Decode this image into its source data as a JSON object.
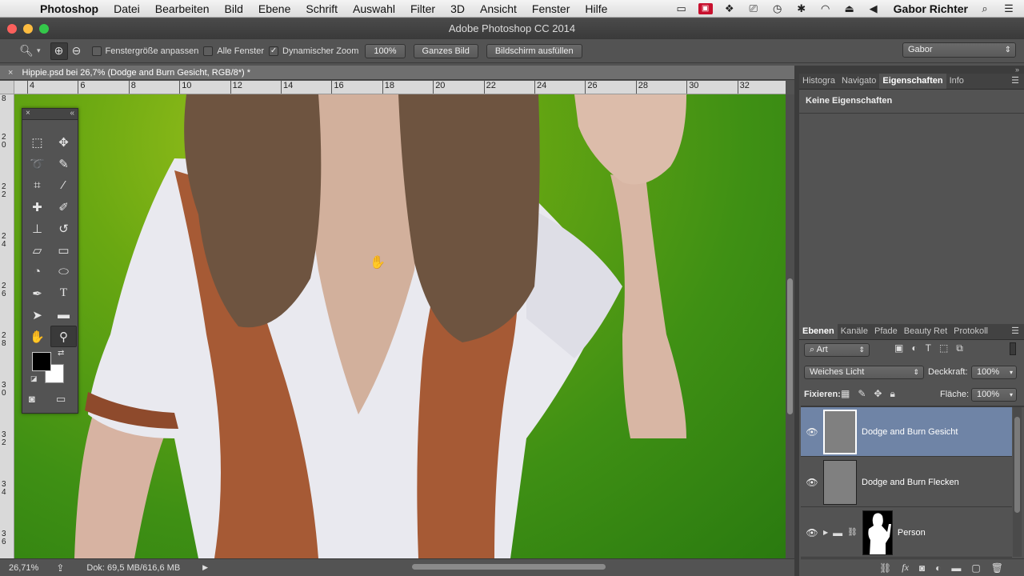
{
  "menubar": {
    "app": "Photoshop",
    "items": [
      "Datei",
      "Bearbeiten",
      "Bild",
      "Ebene",
      "Schrift",
      "Auswahl",
      "Filter",
      "3D",
      "Ansicht",
      "Fenster",
      "Hilfe"
    ],
    "user": "Gabor Richter"
  },
  "window": {
    "title": "Adobe Photoshop CC 2014"
  },
  "options": {
    "fit_window": "Fenstergröße anpassen",
    "all_windows": "Alle Fenster",
    "dynamic_zoom": "Dynamischer Zoom",
    "zoom_value": "100%",
    "full_image": "Ganzes Bild",
    "fill_screen": "Bildschirm ausfüllen",
    "workspace": "Gabor"
  },
  "document": {
    "tab_title": "Hippie.psd bei 26,7% (Dodge and Burn Gesicht, RGB/8*) *",
    "ruler_h": [
      "4",
      "6",
      "8",
      "10",
      "12",
      "14",
      "16",
      "18",
      "20",
      "22",
      "24",
      "26",
      "28",
      "30",
      "32"
    ],
    "ruler_v": [
      "8",
      "20",
      "22",
      "24",
      "26",
      "28",
      "30",
      "32",
      "34",
      "36"
    ]
  },
  "status": {
    "zoom": "26,71%",
    "doc_size": "Dok: 69,5 MB/616,6 MB"
  },
  "properties_panel": {
    "tabs": [
      "Histogra",
      "Navigato",
      "Eigenschaften",
      "Info"
    ],
    "active_tab": "Eigenschaften",
    "message": "Keine Eigenschaften"
  },
  "layers_panel": {
    "tabs": [
      "Ebenen",
      "Kanäle",
      "Pfade",
      "Beauty Ret",
      "Protokoll"
    ],
    "filter_kind": "Art",
    "blend_mode": "Weiches Licht",
    "opacity_label": "Deckkraft:",
    "opacity": "100%",
    "lock_label": "Fixieren:",
    "fill_label": "Fläche:",
    "fill": "100%",
    "layers": [
      {
        "name": "Dodge and Burn Gesicht",
        "selected": true
      },
      {
        "name": "Dodge and Burn Flecken",
        "selected": false
      },
      {
        "name": "Person",
        "selected": false
      }
    ]
  },
  "colors": {
    "foreground": "#000000",
    "background": "#ffffff",
    "selection": "#6f84a6"
  }
}
